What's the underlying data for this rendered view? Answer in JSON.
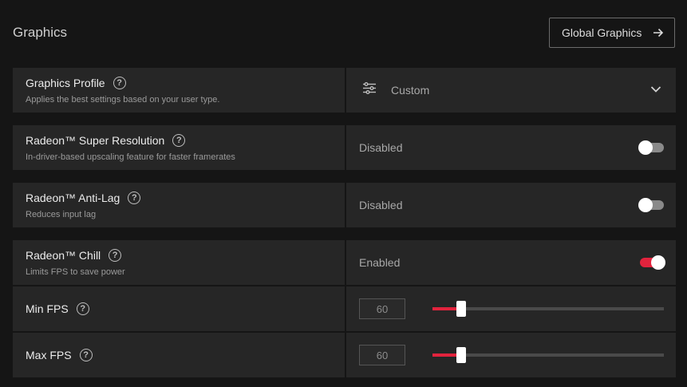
{
  "header": {
    "title": "Graphics",
    "global_button": "Global Graphics"
  },
  "rows": {
    "profile": {
      "name": "Graphics Profile",
      "desc": "Applies the best settings based on your user type.",
      "value": "Custom"
    },
    "rsr": {
      "name": "Radeon™ Super Resolution",
      "desc": "In-driver-based upscaling feature for faster framerates",
      "state": "Disabled",
      "enabled": false
    },
    "antilag": {
      "name": "Radeon™ Anti-Lag",
      "desc": "Reduces input lag",
      "state": "Disabled",
      "enabled": false
    },
    "chill": {
      "name": "Radeon™ Chill",
      "desc": "Limits FPS to save power",
      "state": "Enabled",
      "enabled": true
    },
    "min_fps": {
      "name": "Min FPS",
      "value": "60",
      "slider_fraction": 0.125
    },
    "max_fps": {
      "name": "Max FPS",
      "value": "60",
      "slider_fraction": 0.125
    }
  },
  "help_glyph": "?",
  "colors": {
    "accent": "#e2233d",
    "background": "#151515",
    "panel": "#262626"
  },
  "icons": {
    "profile": "profile-sliders-icon",
    "dropdown": "chevron-down-icon",
    "arrow": "arrow-right-icon",
    "help": "help-circle-icon"
  }
}
